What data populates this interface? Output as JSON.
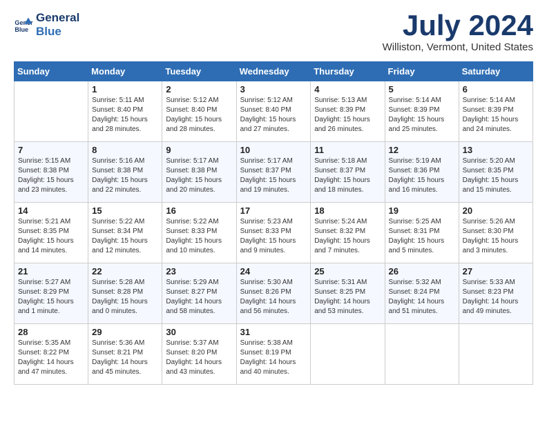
{
  "logo": {
    "line1": "General",
    "line2": "Blue"
  },
  "title": "July 2024",
  "location": "Williston, Vermont, United States",
  "days_of_week": [
    "Sunday",
    "Monday",
    "Tuesday",
    "Wednesday",
    "Thursday",
    "Friday",
    "Saturday"
  ],
  "weeks": [
    [
      {
        "day": "",
        "sunrise": "",
        "sunset": "",
        "daylight": ""
      },
      {
        "day": "1",
        "sunrise": "Sunrise: 5:11 AM",
        "sunset": "Sunset: 8:40 PM",
        "daylight": "Daylight: 15 hours and 28 minutes."
      },
      {
        "day": "2",
        "sunrise": "Sunrise: 5:12 AM",
        "sunset": "Sunset: 8:40 PM",
        "daylight": "Daylight: 15 hours and 28 minutes."
      },
      {
        "day": "3",
        "sunrise": "Sunrise: 5:12 AM",
        "sunset": "Sunset: 8:40 PM",
        "daylight": "Daylight: 15 hours and 27 minutes."
      },
      {
        "day": "4",
        "sunrise": "Sunrise: 5:13 AM",
        "sunset": "Sunset: 8:39 PM",
        "daylight": "Daylight: 15 hours and 26 minutes."
      },
      {
        "day": "5",
        "sunrise": "Sunrise: 5:14 AM",
        "sunset": "Sunset: 8:39 PM",
        "daylight": "Daylight: 15 hours and 25 minutes."
      },
      {
        "day": "6",
        "sunrise": "Sunrise: 5:14 AM",
        "sunset": "Sunset: 8:39 PM",
        "daylight": "Daylight: 15 hours and 24 minutes."
      }
    ],
    [
      {
        "day": "7",
        "sunrise": "Sunrise: 5:15 AM",
        "sunset": "Sunset: 8:38 PM",
        "daylight": "Daylight: 15 hours and 23 minutes."
      },
      {
        "day": "8",
        "sunrise": "Sunrise: 5:16 AM",
        "sunset": "Sunset: 8:38 PM",
        "daylight": "Daylight: 15 hours and 22 minutes."
      },
      {
        "day": "9",
        "sunrise": "Sunrise: 5:17 AM",
        "sunset": "Sunset: 8:38 PM",
        "daylight": "Daylight: 15 hours and 20 minutes."
      },
      {
        "day": "10",
        "sunrise": "Sunrise: 5:17 AM",
        "sunset": "Sunset: 8:37 PM",
        "daylight": "Daylight: 15 hours and 19 minutes."
      },
      {
        "day": "11",
        "sunrise": "Sunrise: 5:18 AM",
        "sunset": "Sunset: 8:37 PM",
        "daylight": "Daylight: 15 hours and 18 minutes."
      },
      {
        "day": "12",
        "sunrise": "Sunrise: 5:19 AM",
        "sunset": "Sunset: 8:36 PM",
        "daylight": "Daylight: 15 hours and 16 minutes."
      },
      {
        "day": "13",
        "sunrise": "Sunrise: 5:20 AM",
        "sunset": "Sunset: 8:35 PM",
        "daylight": "Daylight: 15 hours and 15 minutes."
      }
    ],
    [
      {
        "day": "14",
        "sunrise": "Sunrise: 5:21 AM",
        "sunset": "Sunset: 8:35 PM",
        "daylight": "Daylight: 15 hours and 14 minutes."
      },
      {
        "day": "15",
        "sunrise": "Sunrise: 5:22 AM",
        "sunset": "Sunset: 8:34 PM",
        "daylight": "Daylight: 15 hours and 12 minutes."
      },
      {
        "day": "16",
        "sunrise": "Sunrise: 5:22 AM",
        "sunset": "Sunset: 8:33 PM",
        "daylight": "Daylight: 15 hours and 10 minutes."
      },
      {
        "day": "17",
        "sunrise": "Sunrise: 5:23 AM",
        "sunset": "Sunset: 8:33 PM",
        "daylight": "Daylight: 15 hours and 9 minutes."
      },
      {
        "day": "18",
        "sunrise": "Sunrise: 5:24 AM",
        "sunset": "Sunset: 8:32 PM",
        "daylight": "Daylight: 15 hours and 7 minutes."
      },
      {
        "day": "19",
        "sunrise": "Sunrise: 5:25 AM",
        "sunset": "Sunset: 8:31 PM",
        "daylight": "Daylight: 15 hours and 5 minutes."
      },
      {
        "day": "20",
        "sunrise": "Sunrise: 5:26 AM",
        "sunset": "Sunset: 8:30 PM",
        "daylight": "Daylight: 15 hours and 3 minutes."
      }
    ],
    [
      {
        "day": "21",
        "sunrise": "Sunrise: 5:27 AM",
        "sunset": "Sunset: 8:29 PM",
        "daylight": "Daylight: 15 hours and 1 minute."
      },
      {
        "day": "22",
        "sunrise": "Sunrise: 5:28 AM",
        "sunset": "Sunset: 8:28 PM",
        "daylight": "Daylight: 15 hours and 0 minutes."
      },
      {
        "day": "23",
        "sunrise": "Sunrise: 5:29 AM",
        "sunset": "Sunset: 8:27 PM",
        "daylight": "Daylight: 14 hours and 58 minutes."
      },
      {
        "day": "24",
        "sunrise": "Sunrise: 5:30 AM",
        "sunset": "Sunset: 8:26 PM",
        "daylight": "Daylight: 14 hours and 56 minutes."
      },
      {
        "day": "25",
        "sunrise": "Sunrise: 5:31 AM",
        "sunset": "Sunset: 8:25 PM",
        "daylight": "Daylight: 14 hours and 53 minutes."
      },
      {
        "day": "26",
        "sunrise": "Sunrise: 5:32 AM",
        "sunset": "Sunset: 8:24 PM",
        "daylight": "Daylight: 14 hours and 51 minutes."
      },
      {
        "day": "27",
        "sunrise": "Sunrise: 5:33 AM",
        "sunset": "Sunset: 8:23 PM",
        "daylight": "Daylight: 14 hours and 49 minutes."
      }
    ],
    [
      {
        "day": "28",
        "sunrise": "Sunrise: 5:35 AM",
        "sunset": "Sunset: 8:22 PM",
        "daylight": "Daylight: 14 hours and 47 minutes."
      },
      {
        "day": "29",
        "sunrise": "Sunrise: 5:36 AM",
        "sunset": "Sunset: 8:21 PM",
        "daylight": "Daylight: 14 hours and 45 minutes."
      },
      {
        "day": "30",
        "sunrise": "Sunrise: 5:37 AM",
        "sunset": "Sunset: 8:20 PM",
        "daylight": "Daylight: 14 hours and 43 minutes."
      },
      {
        "day": "31",
        "sunrise": "Sunrise: 5:38 AM",
        "sunset": "Sunset: 8:19 PM",
        "daylight": "Daylight: 14 hours and 40 minutes."
      },
      {
        "day": "",
        "sunrise": "",
        "sunset": "",
        "daylight": ""
      },
      {
        "day": "",
        "sunrise": "",
        "sunset": "",
        "daylight": ""
      },
      {
        "day": "",
        "sunrise": "",
        "sunset": "",
        "daylight": ""
      }
    ]
  ]
}
